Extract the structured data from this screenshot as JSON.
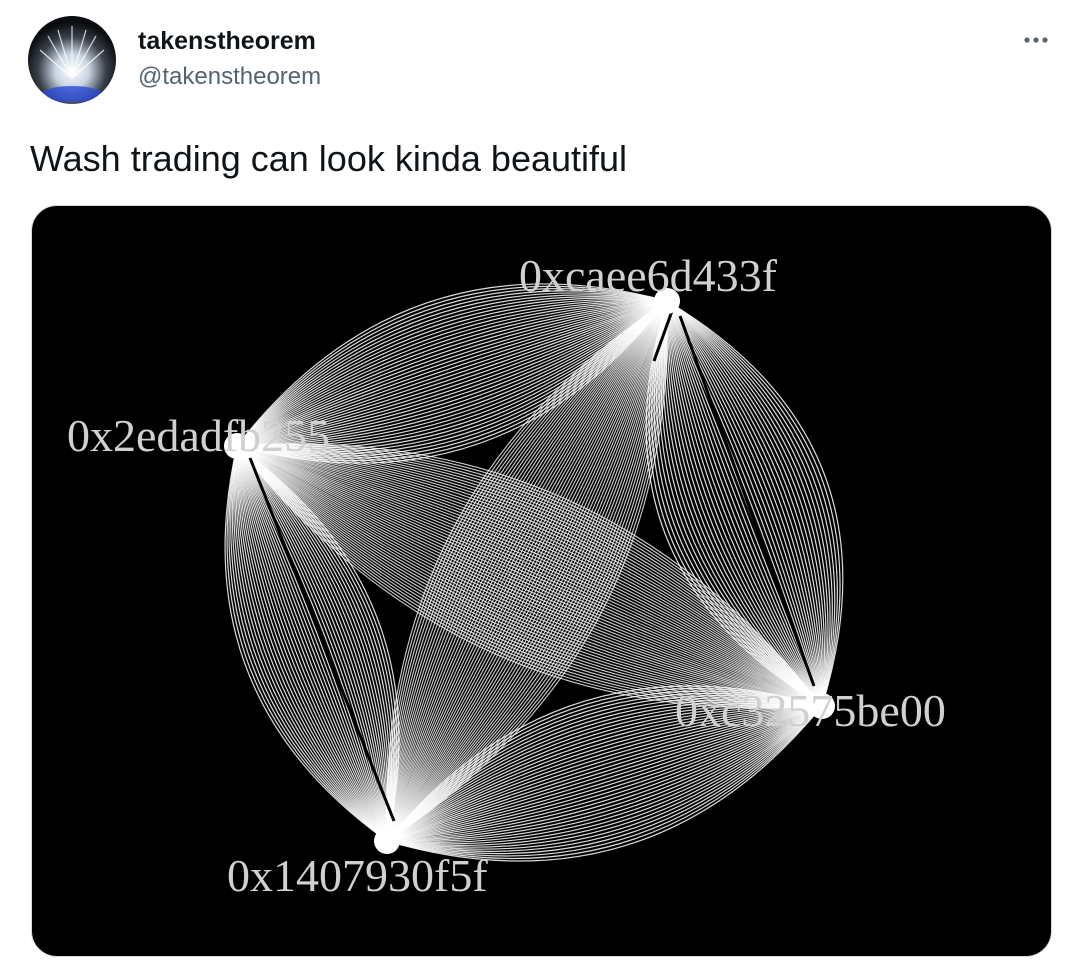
{
  "tweet": {
    "display_name": "takenstheorem",
    "handle": "@takenstheorem",
    "text": "Wash trading can look kinda beautiful",
    "more_icon": "more-dots-icon",
    "avatar_icon": "profile-avatar"
  },
  "media": {
    "nodes": [
      {
        "id": "top",
        "label": "0xcaee6d433f"
      },
      {
        "id": "left",
        "label": "0x2edadfb255"
      },
      {
        "id": "right",
        "label": "0xc32575be00"
      },
      {
        "id": "bottom",
        "label": "0x1407930f5f"
      }
    ],
    "colors": {
      "background": "#000000",
      "edges": "#ffffff",
      "labels": "#d0d0d0"
    }
  }
}
